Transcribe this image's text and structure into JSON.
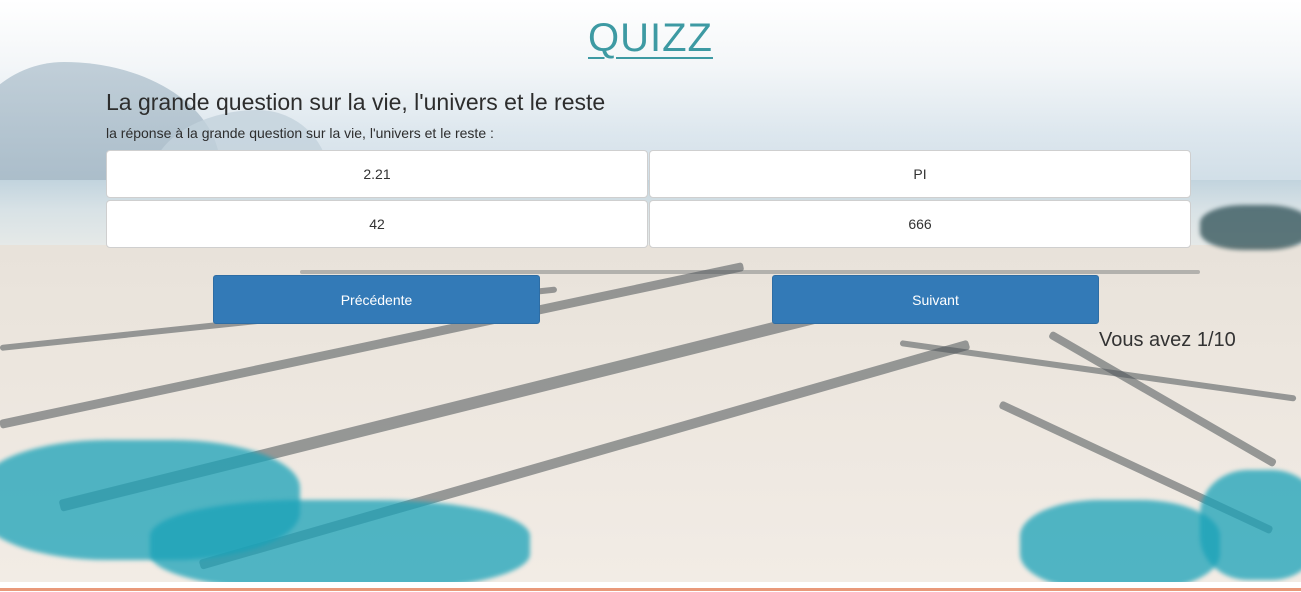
{
  "page": {
    "title": "QUIZZ"
  },
  "question": {
    "title": "La grande question sur la vie, l'univers et le reste",
    "text": "la réponse à la grande question sur la vie, l'univers et le reste :",
    "answers": [
      {
        "label": "2.21"
      },
      {
        "label": "PI"
      },
      {
        "label": "42"
      },
      {
        "label": "666"
      }
    ]
  },
  "navigation": {
    "prev_label": "Précédente",
    "next_label": "Suivant"
  },
  "score": {
    "text": "Vous avez 1/10"
  },
  "colors": {
    "title": "#3d9aa3",
    "button": "#337ab7",
    "bottom_accent": "#e9997a"
  }
}
